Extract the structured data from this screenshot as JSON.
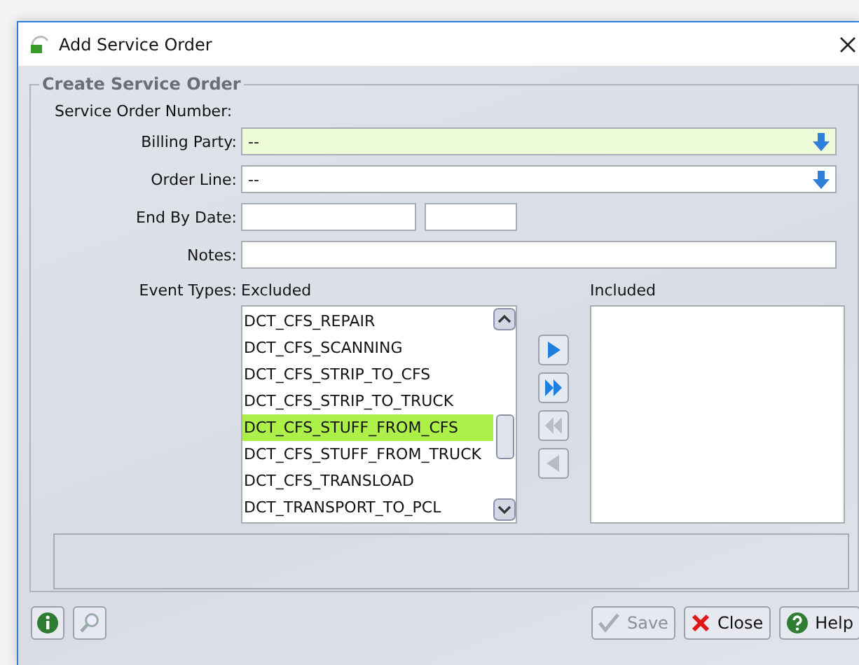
{
  "window": {
    "title": "Add Service Order"
  },
  "group": {
    "title": "Create Service Order"
  },
  "form": {
    "service_order_number_label": "Service Order Number:",
    "billing_party": {
      "label": "Billing Party:",
      "value": "--",
      "required": true
    },
    "order_line": {
      "label": "Order Line:",
      "value": "--",
      "required": false
    },
    "end_by_date": {
      "label": "End By Date:"
    },
    "notes": {
      "label": "Notes:"
    }
  },
  "event_types": {
    "label": "Event Types:",
    "excluded_label": "Excluded",
    "included_label": "Included",
    "excluded": [
      {
        "text": "DCT_CFS_REPAIR",
        "selected": false
      },
      {
        "text": "DCT_CFS_SCANNING",
        "selected": false
      },
      {
        "text": "DCT_CFS_STRIP_TO_CFS",
        "selected": false
      },
      {
        "text": "DCT_CFS_STRIP_TO_TRUCK",
        "selected": false
      },
      {
        "text": "DCT_CFS_STUFF_FROM_CFS",
        "selected": true
      },
      {
        "text": "DCT_CFS_STUFF_FROM_TRUCK",
        "selected": false
      },
      {
        "text": "DCT_CFS_TRANSLOAD",
        "selected": false
      },
      {
        "text": "DCT_TRANSPORT_TO_PCL",
        "selected": false
      }
    ],
    "move_buttons": [
      {
        "kind": "add",
        "disabled": false
      },
      {
        "kind": "add_all",
        "disabled": false
      },
      {
        "kind": "remove_all",
        "disabled": true
      },
      {
        "kind": "remove",
        "disabled": true
      }
    ]
  },
  "footer": {
    "buttons": [
      {
        "label": "Save",
        "kind": "save",
        "disabled": true
      },
      {
        "label": "Close",
        "kind": "close",
        "disabled": false
      },
      {
        "label": "Help",
        "kind": "help",
        "disabled": false
      }
    ]
  }
}
